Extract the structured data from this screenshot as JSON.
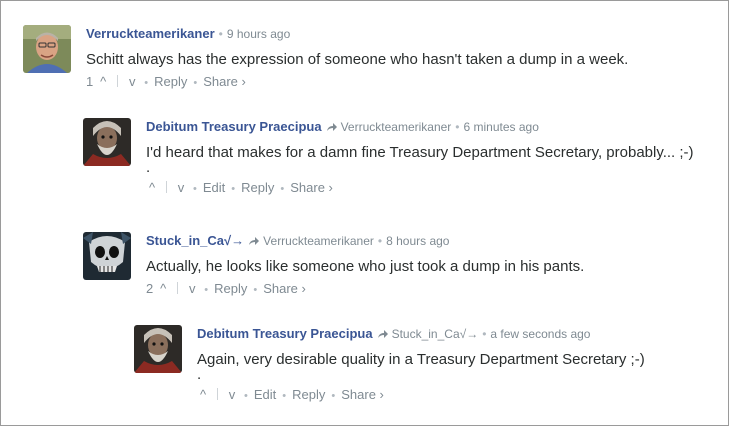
{
  "comments": [
    {
      "author": "Verruckteamerikaner",
      "reply_to": "",
      "time": "9 hours ago",
      "text": "Schitt always has the expression of someone who hasn't taken a dump in a week.",
      "extra_line": "",
      "votes": "1",
      "actions": [
        "Reply",
        "Share ›"
      ]
    },
    {
      "author": "Debitum Treasury Praecipua",
      "reply_to": "Verruckteamerikaner",
      "time": "6 minutes ago",
      "text": "I'd heard that makes for a damn fine Treasury Department Secretary, probably... ;-)",
      "extra_line": ".",
      "votes": "",
      "actions": [
        "Edit",
        "Reply",
        "Share ›"
      ]
    },
    {
      "author": "Stuck_in_Ca√→",
      "reply_to": "Verruckteamerikaner",
      "time": "8 hours ago",
      "text": "Actually, he looks like someone who just took a dump in his pants.",
      "extra_line": "",
      "votes": "2",
      "actions": [
        "Reply",
        "Share ›"
      ]
    },
    {
      "author": "Debitum Treasury Praecipua",
      "reply_to": "Stuck_in_Ca√→",
      "time": "a few seconds ago",
      "text": "Again, very desirable quality in a Treasury Department Secretary ;-)",
      "extra_line": ".",
      "votes": "",
      "actions": [
        "Edit",
        "Reply",
        "Share ›"
      ]
    }
  ],
  "glyphs": {
    "upvote": "^",
    "downvote": "v",
    "bullet": "•"
  },
  "icons": {
    "reply_arrow": "reply-arrow-icon"
  },
  "colors": {
    "author": "#3a5594",
    "meta": "#7f8a92",
    "text": "#2a2e2e"
  }
}
